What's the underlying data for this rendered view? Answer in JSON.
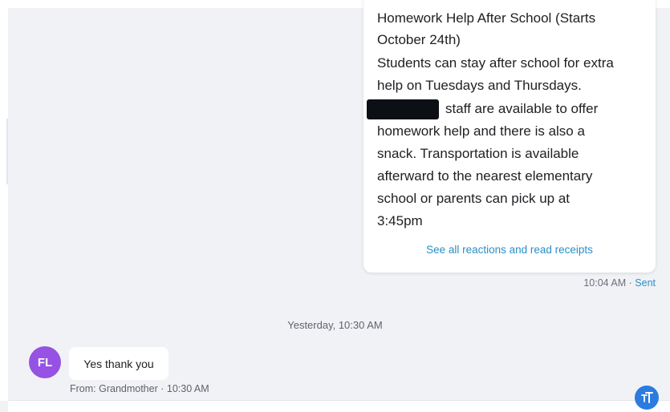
{
  "outgoing_message": {
    "lines": [
      "Homework Help After School (Starts",
      "October 24th)",
      "Students can stay after school for extra",
      "help on Tuesdays and Thursdays.",
      "staff are available to offer",
      "homework help and there is also a",
      "snack. Transportation is available",
      "afterward to the nearest elementary",
      "school or parents can pick up at",
      "3:45pm"
    ],
    "reactions_link": "See all reactions and read receipts",
    "time": "10:04 AM",
    "separator": " · ",
    "status": "Sent"
  },
  "date_divider": "Yesterday, 10:30 AM",
  "incoming_message": {
    "avatar_initials": "FL",
    "avatar_color": "#9652e3",
    "text": "Yes thank you",
    "meta": "From: Grandmother · 10:30 AM"
  },
  "text_size_button": {
    "icon": "text-size-icon",
    "color": "#2b7be0"
  },
  "colors": {
    "accent_link": "#2b8fc7",
    "background": "#f1f2f6"
  }
}
